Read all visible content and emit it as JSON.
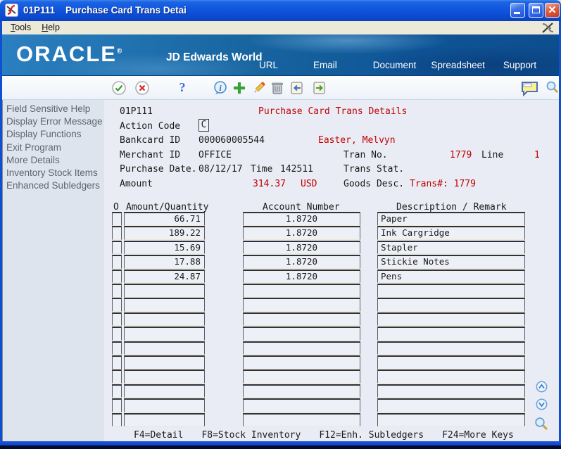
{
  "colors": {
    "titlebar_blue": "#0f55dd",
    "banner_blue": "#0d4d8d",
    "red_text": "#c00000",
    "sidebar_bg": "#dde4ee",
    "main_bg": "#e9ecf4"
  },
  "window": {
    "title": "01P111    Purchase Card Trans Detai",
    "controls": [
      "minimize",
      "maximize",
      "close"
    ]
  },
  "menu_bar": {
    "items": [
      "Tools",
      "Help"
    ]
  },
  "banner": {
    "logo": "ORACLE",
    "logo_reg": "®",
    "logo_sub": "JD Edwards World",
    "links": [
      "URL",
      "Email",
      "Document",
      "Spreadsheet",
      "Support"
    ]
  },
  "toolbar": {
    "icons": [
      "ok",
      "cancel",
      "help",
      "info",
      "add",
      "edit",
      "delete",
      "prev-record",
      "next-record",
      "notes",
      "search"
    ]
  },
  "sidebar": {
    "items": [
      "Field Sensitive Help",
      "Display Error Message",
      "Display Functions",
      "Exit Program",
      "More Details",
      "Inventory Stock Items",
      "Enhanced Subledgers"
    ]
  },
  "form": {
    "program_id": "01P111",
    "title": "Purchase Card Trans Details",
    "action_code_label": "Action Code",
    "action_code_value": "C",
    "bankcard_label": "Bankcard ID",
    "bankcard_value": "000060005544",
    "cardholder_name": "Easter, Melvyn",
    "merchant_label": "Merchant ID",
    "merchant_value": "OFFICE",
    "tran_no_label": "Tran No.",
    "tran_no_value": "1779",
    "line_label": "Line",
    "line_value": "1",
    "purchase_date_label": "Purchase Date.",
    "purchase_date_value": "08/12/17",
    "time_label": "Time",
    "time_value": "142511",
    "trans_stat_label": "Trans Stat.",
    "amount_label": "Amount",
    "amount_value": "314.37",
    "currency": "USD",
    "goods_desc_label": "Goods Desc.",
    "trans_ref": "Trans#: 1779"
  },
  "grid": {
    "columns": [
      "O",
      "Amount/Quantity",
      "Account Number",
      "Description / Remark"
    ],
    "rows": [
      {
        "o": "",
        "amount": "66.71",
        "account": "1.8720",
        "description": "Paper"
      },
      {
        "o": "",
        "amount": "189.22",
        "account": "1.8720",
        "description": "Ink Cargridge"
      },
      {
        "o": "",
        "amount": "15.69",
        "account": "1.8720",
        "description": "Stapler"
      },
      {
        "o": "",
        "amount": "17.88",
        "account": "1.8720",
        "description": "Stickie Notes"
      },
      {
        "o": "",
        "amount": "24.87",
        "account": "1.8720",
        "description": "Pens"
      },
      {
        "o": "",
        "amount": "",
        "account": "",
        "description": ""
      },
      {
        "o": "",
        "amount": "",
        "account": "",
        "description": ""
      },
      {
        "o": "",
        "amount": "",
        "account": "",
        "description": ""
      },
      {
        "o": "",
        "amount": "",
        "account": "",
        "description": ""
      },
      {
        "o": "",
        "amount": "",
        "account": "",
        "description": ""
      },
      {
        "o": "",
        "amount": "",
        "account": "",
        "description": ""
      },
      {
        "o": "",
        "amount": "",
        "account": "",
        "description": ""
      },
      {
        "o": "",
        "amount": "",
        "account": "",
        "description": ""
      },
      {
        "o": "",
        "amount": "",
        "account": "",
        "description": ""
      },
      {
        "o": "",
        "amount": "",
        "account": "",
        "description": ""
      }
    ]
  },
  "footer": {
    "function_keys": [
      "F4=Detail",
      "F8=Stock Inventory",
      "F12=Enh. Subledgers",
      "F24=More Keys"
    ]
  }
}
